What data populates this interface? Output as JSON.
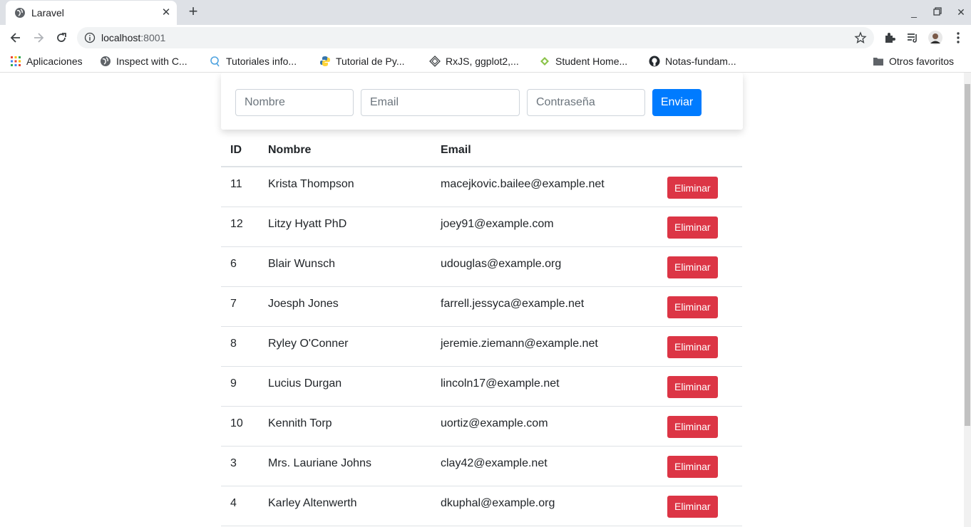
{
  "browser": {
    "tab_title": "Laravel",
    "url_host": "localhost",
    "url_port": ":8001",
    "bookmarks": [
      {
        "label": "Aplicaciones",
        "icon": "apps-grid-icon"
      },
      {
        "label": "Inspect with C...",
        "icon": "globe-icon"
      },
      {
        "label": "Tutoriales info...",
        "icon": "search-bubble-icon"
      },
      {
        "label": "Tutorial de Py...",
        "icon": "python-icon"
      },
      {
        "label": "RxJS, ggplot2,...",
        "icon": "diamond-icon"
      },
      {
        "label": "Student Home...",
        "icon": "leaf-icon"
      },
      {
        "label": "Notas-fundam...",
        "icon": "github-icon"
      }
    ],
    "other_bookmarks": "Otros favoritos"
  },
  "form": {
    "name_placeholder": "Nombre",
    "email_placeholder": "Email",
    "password_placeholder": "Contraseña",
    "submit_label": "Enviar"
  },
  "table": {
    "headers": [
      "ID",
      "Nombre",
      "Email"
    ],
    "delete_label": "Eliminar",
    "rows": [
      {
        "id": "11",
        "name": "Krista Thompson",
        "email": "macejkovic.bailee@example.net"
      },
      {
        "id": "12",
        "name": "Litzy Hyatt PhD",
        "email": "joey91@example.com"
      },
      {
        "id": "6",
        "name": "Blair Wunsch",
        "email": "udouglas@example.org"
      },
      {
        "id": "7",
        "name": "Joesph Jones",
        "email": "farrell.jessyca@example.net"
      },
      {
        "id": "8",
        "name": "Ryley O'Conner",
        "email": "jeremie.ziemann@example.net"
      },
      {
        "id": "9",
        "name": "Lucius Durgan",
        "email": "lincoln17@example.net"
      },
      {
        "id": "10",
        "name": "Kennith Torp",
        "email": "uortiz@example.com"
      },
      {
        "id": "3",
        "name": "Mrs. Lauriane Johns",
        "email": "clay42@example.net"
      },
      {
        "id": "4",
        "name": "Karley Altenwerth",
        "email": "dkuphal@example.org"
      }
    ]
  },
  "colors": {
    "primary": "#007bff",
    "danger": "#dc3545"
  }
}
